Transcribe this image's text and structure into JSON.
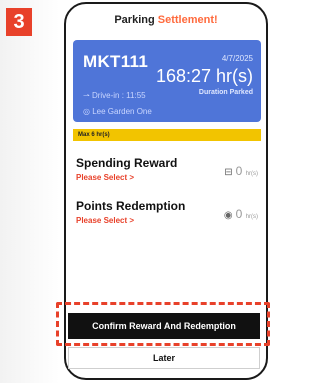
{
  "step_badge": "3",
  "header": {
    "title_prefix": "Parking ",
    "title_accent": "Settlement!"
  },
  "card": {
    "plate": "MKT111",
    "date": "4/7/2025",
    "duration": "168:27 hr(s)",
    "duration_label": "Duration Parked",
    "drive_in": "Drive-in : 11:55",
    "location": "Lee Garden One"
  },
  "max_notice": "Max 6 hr(s)",
  "spending_reward": {
    "title": "Spending Reward",
    "link": "Please Select >",
    "value": "0",
    "unit": "hr(s)",
    "icon": "receipt-icon"
  },
  "points_redemption": {
    "title": "Points Redemption",
    "link": "Please Select >",
    "value": "0",
    "unit": "hr(s)",
    "icon": "points-coin-icon"
  },
  "buttons": {
    "confirm": "Confirm Reward And Redemption",
    "later": "Later"
  },
  "colors": {
    "accent": "#e8412a",
    "card_blue": "#4f75d8",
    "notice_yellow": "#f2c400"
  }
}
